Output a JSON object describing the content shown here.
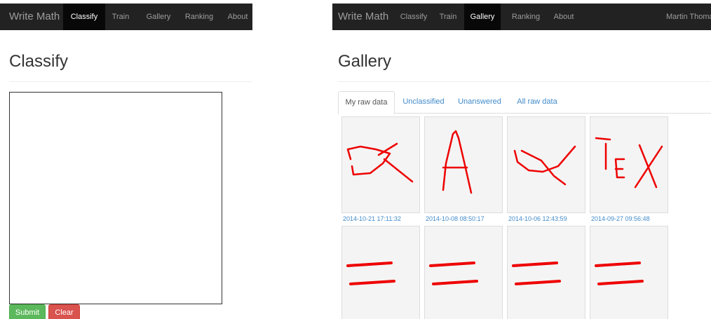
{
  "classify_page": {
    "navbar": {
      "brand": "Write Math",
      "items": [
        {
          "label": "Classify",
          "active": true
        },
        {
          "label": "Train",
          "active": false
        },
        {
          "label": "Gallery",
          "active": false
        },
        {
          "label": "Ranking",
          "active": false
        },
        {
          "label": "About",
          "active": false
        }
      ]
    },
    "title": "Classify",
    "buttons": {
      "submit": "Submit",
      "clear": "Clear"
    },
    "colors": {
      "submit": "#5cb85c",
      "clear": "#d9534f",
      "navbar": "#222222"
    }
  },
  "gallery_page": {
    "navbar": {
      "brand": "Write Math",
      "items": [
        {
          "label": "Classify",
          "active": false
        },
        {
          "label": "Train",
          "active": false
        },
        {
          "label": "Gallery",
          "active": true
        },
        {
          "label": "Ranking",
          "active": false
        },
        {
          "label": "About",
          "active": false
        }
      ],
      "user": "Martin Thoma"
    },
    "title": "Gallery",
    "tabs": [
      {
        "label": "My raw data",
        "active": true
      },
      {
        "label": "Unclassified",
        "active": false
      },
      {
        "label": "Unanswered",
        "active": false
      },
      {
        "label": "All raw data",
        "active": false
      }
    ],
    "items": [
      {
        "date": "2014-10-21 17:11:32",
        "drawing": "alpha"
      },
      {
        "date": "2014-10-08 08:50:17",
        "drawing": "A"
      },
      {
        "date": "2014-10-06 12:43:59",
        "drawing": "alpha"
      },
      {
        "date": "2014-09-27 09:56:48",
        "drawing": "TEX"
      },
      {
        "drawing": "equals"
      },
      {
        "drawing": "equals"
      },
      {
        "drawing": "equals"
      },
      {
        "drawing": "equals"
      }
    ],
    "colors": {
      "link": "#428bca",
      "stroke": "#ee0000"
    }
  }
}
